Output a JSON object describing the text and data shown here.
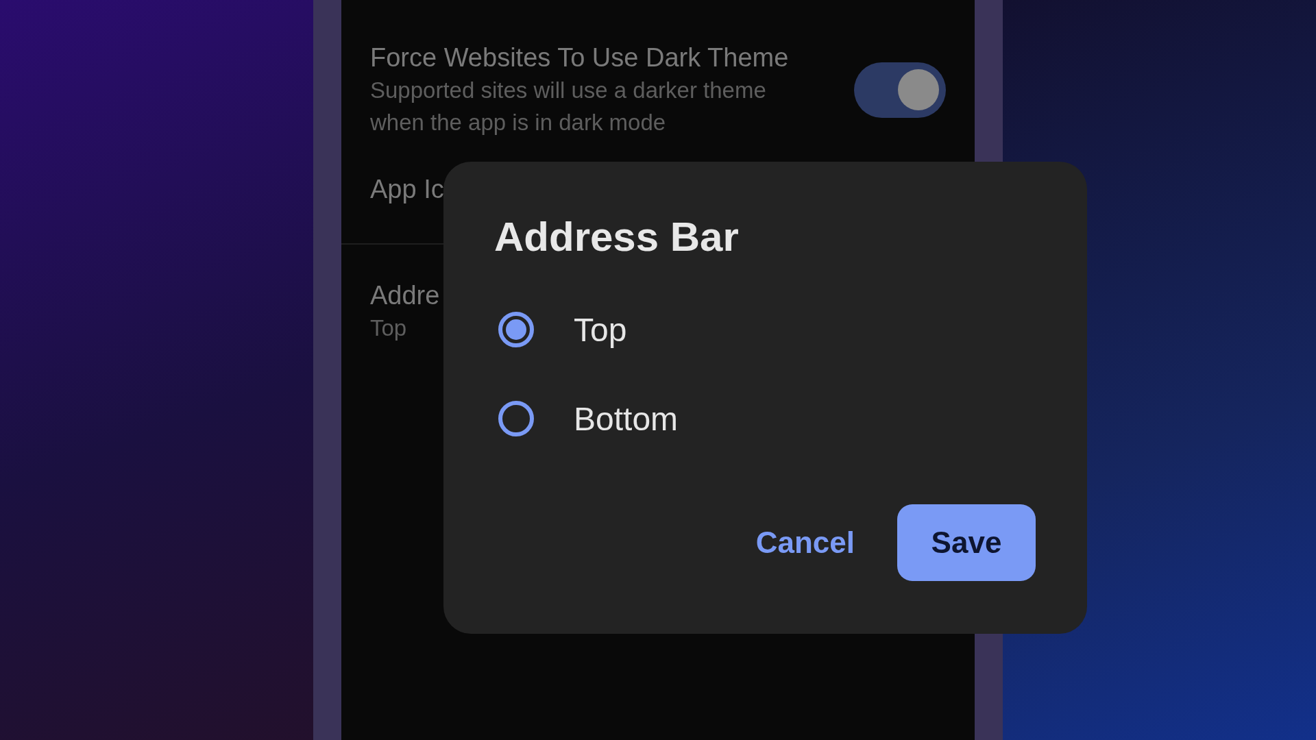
{
  "settings": [
    {
      "kind": "toggle",
      "title": "Force Websites To Use Dark Theme",
      "subtitle": "Supported sites will use a darker theme when the app is in dark mode",
      "on": true
    },
    {
      "kind": "plain",
      "title": "App Ic"
    },
    {
      "kind": "value",
      "title": "Addre",
      "subtitle": "Top"
    }
  ],
  "dialog": {
    "title": "Address Bar",
    "options": [
      {
        "label": "Top",
        "selected": true
      },
      {
        "label": "Bottom",
        "selected": false
      }
    ],
    "buttons": [
      {
        "kind": "text",
        "label": "Cancel"
      },
      {
        "kind": "filled",
        "label": "Save"
      }
    ]
  }
}
